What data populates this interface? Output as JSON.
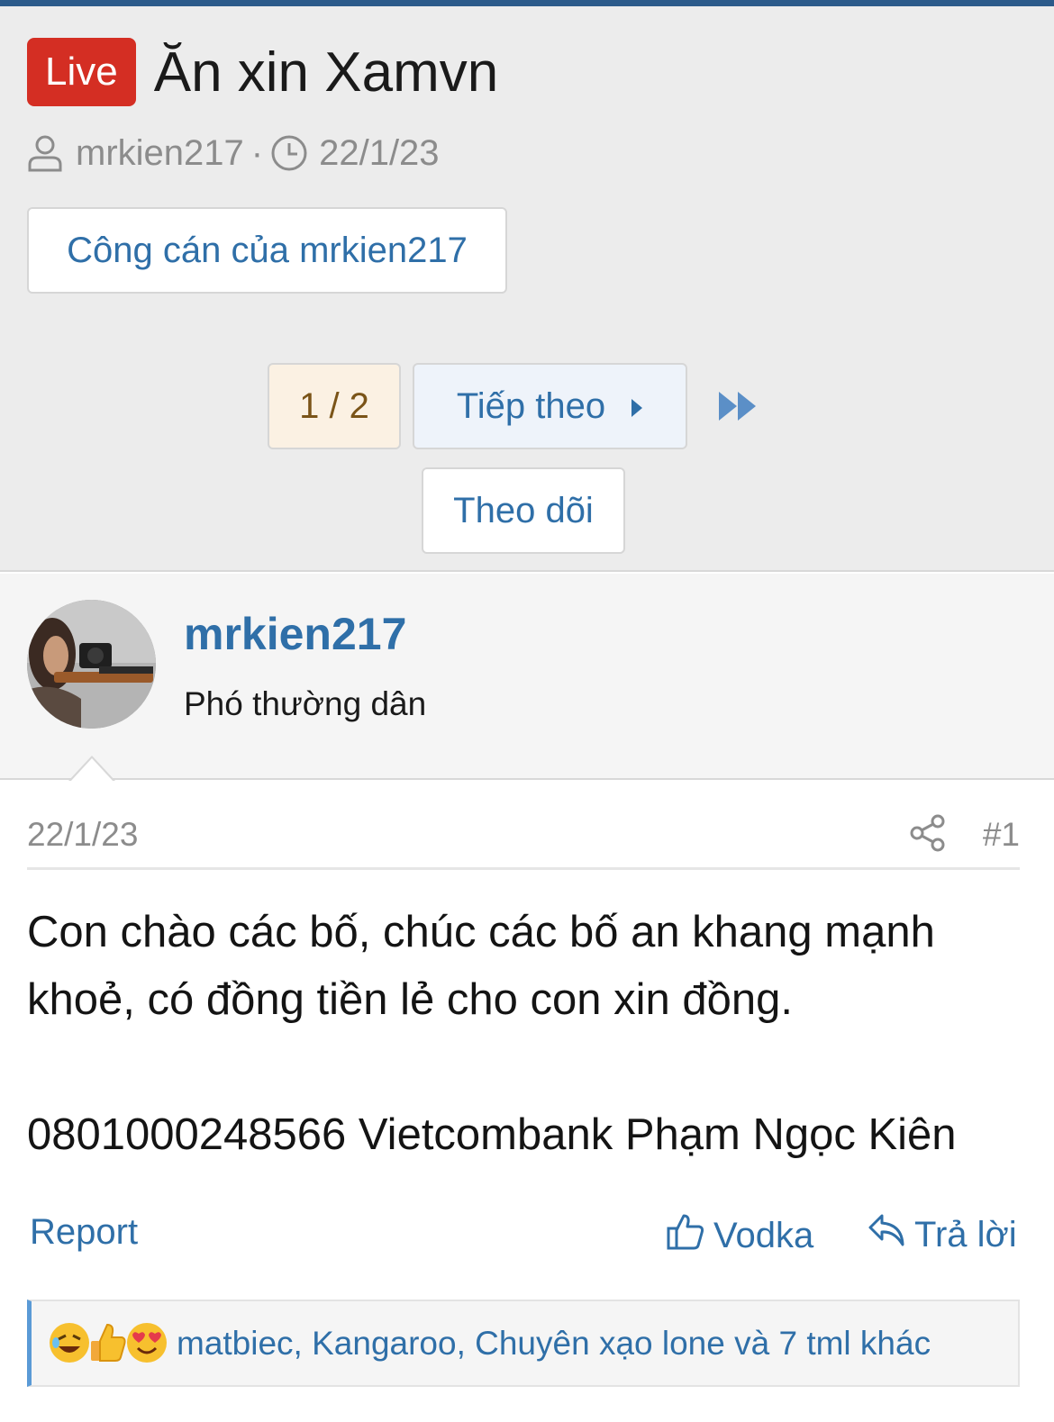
{
  "thread": {
    "badge": "Live",
    "title": "Ăn xin Xamvn",
    "author": "mrkien217",
    "separator": "·",
    "date": "22/1/23"
  },
  "header_buttons": {
    "author_posts": "Công cán của mrkien217",
    "page_indicator": "1 / 2",
    "next": "Tiếp theo",
    "follow": "Theo dõi"
  },
  "post": {
    "username": "mrkien217",
    "rank": "Phó thường dân",
    "date": "22/1/23",
    "number": "#1",
    "body_lines": [
      "Con chào các bố, chúc các bố an khang mạnh",
      "khoẻ, có đồng tiền lẻ cho con xin đồng.",
      "",
      "0801000248566 Vietcombank Phạm Ngọc Kiên"
    ],
    "actions": {
      "report": "Report",
      "react": "Vodka",
      "reply": "Trả lời"
    },
    "reactions": {
      "icons": [
        "rofl-emoji-icon",
        "thumbs-up-emoji-icon",
        "heart-eyes-emoji-icon"
      ],
      "text": "matbiec, Kangaroo, Chuyên xạo lone và 7 tml khác"
    }
  },
  "colors": {
    "accent": "#2f6fa8",
    "live_badge": "#d42e23",
    "topbar": "#2b5a8a",
    "reaction_border": "#5a9ad6"
  }
}
